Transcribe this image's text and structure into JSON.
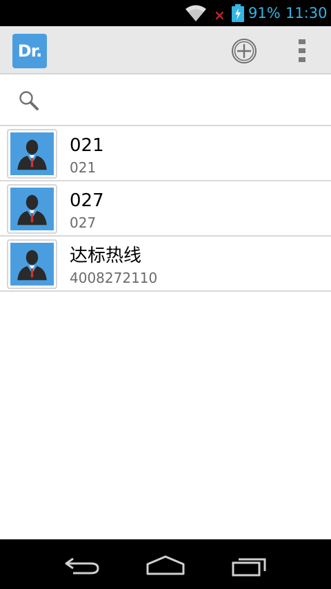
{
  "status_bar": {
    "battery_percent": "91%",
    "time": "11:30",
    "wifi_icon": "wifi-icon",
    "no_signal_icon": "no-signal-x-icon",
    "battery_icon": "battery-charging-icon",
    "colors": {
      "text": "#33b5e5",
      "error": "#c0262c"
    }
  },
  "action_bar": {
    "logo_text": "Dr.",
    "add_icon": "add-circle-icon",
    "overflow_icon": "overflow-menu-icon",
    "colors": {
      "logo_bg": "#4a9ee0",
      "bar_bg": "#e8e8e8"
    }
  },
  "search": {
    "icon": "search-icon",
    "value": "",
    "placeholder": ""
  },
  "contacts": [
    {
      "name": "021",
      "phone": "021",
      "avatar_icon": "person-avatar-icon"
    },
    {
      "name": "027",
      "phone": "027",
      "avatar_icon": "person-avatar-icon"
    },
    {
      "name": "达标热线",
      "phone": "4008272110",
      "avatar_icon": "person-avatar-icon"
    }
  ],
  "nav_bar": {
    "back_icon": "back-icon",
    "home_icon": "home-icon",
    "recents_icon": "recents-icon"
  }
}
